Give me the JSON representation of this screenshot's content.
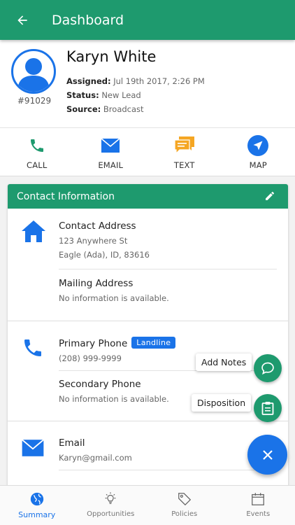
{
  "header": {
    "title": "Dashboard"
  },
  "profile": {
    "name": "Karyn White",
    "lead_id": "#91029",
    "assigned_label": "Assigned:",
    "assigned_value": "Jul 19th 2017, 2:26 PM",
    "status_label": "Status:",
    "status_value": "New Lead",
    "source_label": "Source:",
    "source_value": "Broadcast"
  },
  "actions": [
    {
      "label": "CALL",
      "icon": "phone-icon",
      "color": "#1e9a6e"
    },
    {
      "label": "EMAIL",
      "icon": "email-icon",
      "color": "#1a73e8"
    },
    {
      "label": "TEXT",
      "icon": "chat-icon",
      "color": "#f5a623"
    },
    {
      "label": "MAP",
      "icon": "navigation-icon",
      "color": "#1a73e8"
    }
  ],
  "contact": {
    "title": "Contact Information",
    "address": {
      "title": "Contact Address",
      "line1": "123 Anywhere St",
      "line2": "Eagle (Ada), ID, 83616"
    },
    "mailing": {
      "title": "Mailing Address",
      "value": "No information is available."
    },
    "primary_phone": {
      "title": "Primary Phone",
      "badge": "Landline",
      "value": "(208) 999-9999"
    },
    "secondary_phone": {
      "title": "Secondary Phone",
      "value": "No information is available."
    },
    "email": {
      "title": "Email",
      "value": "Karyn@gmail.com"
    }
  },
  "fab": {
    "add_notes": "Add Notes",
    "disposition": "Disposition"
  },
  "bottom_nav": [
    {
      "label": "Summary",
      "icon": "globe-icon",
      "active": true
    },
    {
      "label": "Opportunities",
      "icon": "lightbulb-icon",
      "active": false
    },
    {
      "label": "Policies",
      "icon": "tag-icon",
      "active": false
    },
    {
      "label": "Events",
      "icon": "calendar-icon",
      "active": false
    }
  ],
  "colors": {
    "primary": "#1e9a6e",
    "accent": "#1a73e8",
    "text_orange": "#f5a623"
  }
}
